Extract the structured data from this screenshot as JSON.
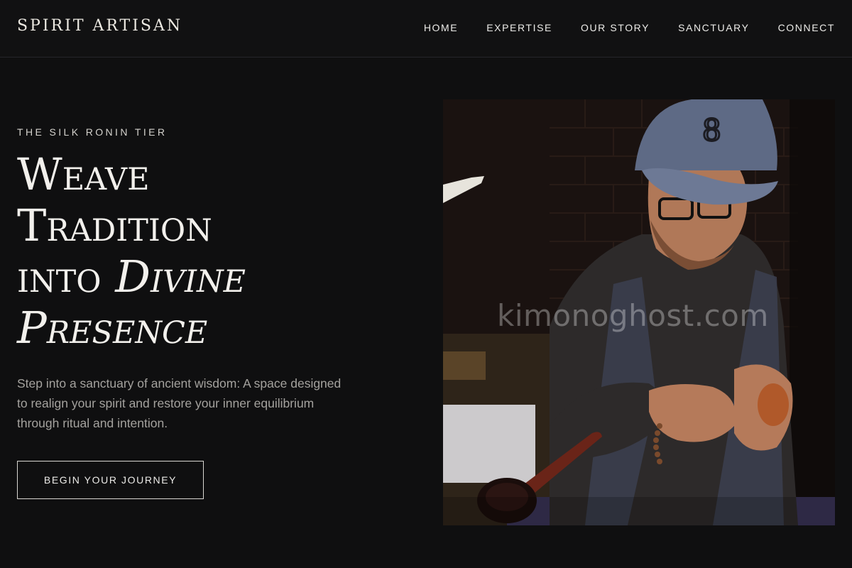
{
  "brand": {
    "name": "SPIRIT ARTISAN"
  },
  "nav": [
    {
      "label": "HOME"
    },
    {
      "label": "EXPERTISE"
    },
    {
      "label": "OUR STORY"
    },
    {
      "label": "SANCTUARY"
    },
    {
      "label": "CONNECT"
    }
  ],
  "hero": {
    "eyebrow": "THE SILK RONIN TIER",
    "headline_line1": "Weave",
    "headline_line2": "Tradition",
    "headline_line3_plain": "into ",
    "headline_line3_em": "Divine",
    "headline_line4_em": "Presence",
    "lede": "Step into a sanctuary of ancient wisdom: A space designed to realign your spirit and restore your inner equilibrium through ritual and intention.",
    "cta_label": "BEGIN YOUR JOURNEY"
  },
  "image": {
    "watermark": "kimonoghost.com",
    "subject": "artisan-carving-pipe-photo"
  }
}
